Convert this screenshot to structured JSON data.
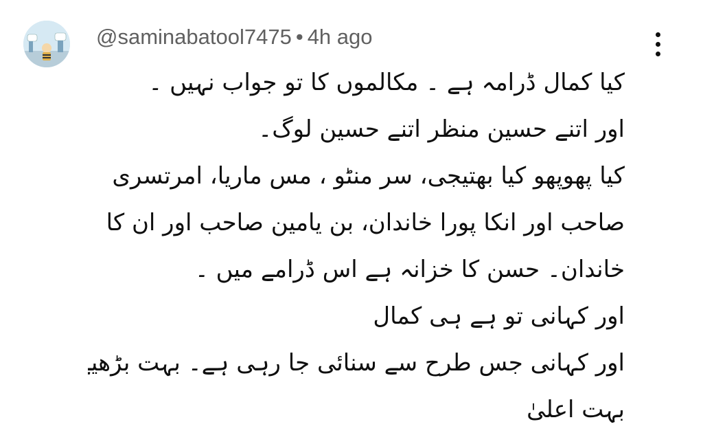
{
  "comment": {
    "username": "@saminabatool7475",
    "separator": "•",
    "time": "4h ago",
    "avatar_icon": "cartoon-avatar-icon",
    "menu_icon": "more-vert-icon",
    "lines": [
      "کیا کمال ڈرامہ ہے ۔ مکالموں کا تو جواب نہیں ۔",
      "اور اتنے حسین منظر اتنے حسین لوگ۔",
      "کیا پھوپھو کیا بھتیجی، سر منٹو ، مس ماریا، امرتسری",
      "صاحب اور انکا پورا خاندان، بن یامین صاحب اور ان کا",
      "خاندان۔ حسن کا خزانہ ہے اس ڈرامے میں ۔",
      "اور کہانی تو ہے ہی کمال",
      "اور کہانی جس طرح سے سنائی جا رہی ہے۔ بہت بڑھیے ،",
      "بہت اعلیٰ"
    ]
  }
}
